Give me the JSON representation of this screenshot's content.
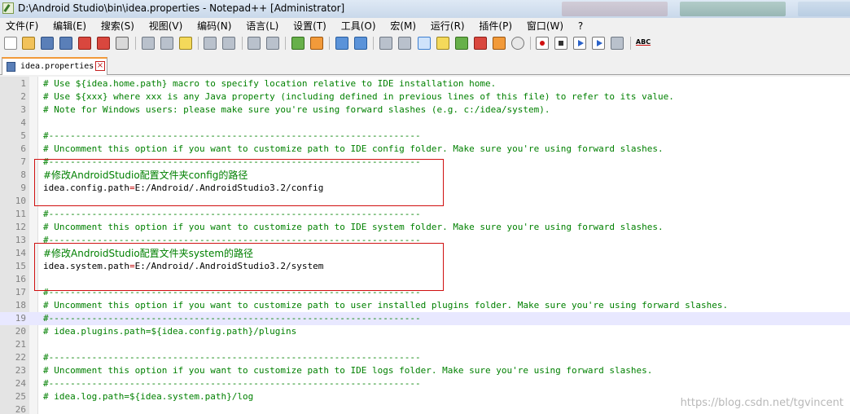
{
  "window": {
    "title": "D:\\Android Studio\\bin\\idea.properties - Notepad++ [Administrator]"
  },
  "menu": [
    "文件(F)",
    "编辑(E)",
    "搜索(S)",
    "视图(V)",
    "编码(N)",
    "语言(L)",
    "设置(T)",
    "工具(O)",
    "宏(M)",
    "运行(R)",
    "插件(P)",
    "窗口(W)",
    "?"
  ],
  "toolbar": {
    "spellcheck_label": "ABC"
  },
  "tab": {
    "label": "idea.properties",
    "close_glyph": "×"
  },
  "editor": {
    "lines": [
      {
        "n": "1",
        "text": "# Use ${idea.home.path} macro to specify location relative to IDE installation home."
      },
      {
        "n": "2",
        "text": "# Use ${xxx} where xxx is any Java property (including defined in previous lines of this file) to refer to its value."
      },
      {
        "n": "3",
        "text": "# Note for Windows users: please make sure you're using forward slashes (e.g. c:/idea/system)."
      },
      {
        "n": "4",
        "text": ""
      },
      {
        "n": "5",
        "text": "#---------------------------------------------------------------------"
      },
      {
        "n": "6",
        "text": "# Uncomment this option if you want to customize path to IDE config folder. Make sure you're using forward slashes."
      },
      {
        "n": "7",
        "text": "#---------------------------------------------------------------------"
      },
      {
        "n": "8",
        "text": "#修改AndroidStudio配置文件夹config的路径"
      },
      {
        "n": "9",
        "key": "idea.config.path",
        "value": "E:/Android/.AndroidStudio3.2/config"
      },
      {
        "n": "10",
        "text": ""
      },
      {
        "n": "11",
        "text": "#---------------------------------------------------------------------"
      },
      {
        "n": "12",
        "text": "# Uncomment this option if you want to customize path to IDE system folder. Make sure you're using forward slashes."
      },
      {
        "n": "13",
        "text": "#---------------------------------------------------------------------"
      },
      {
        "n": "14",
        "text": "#修改AndroidStudio配置文件夹system的路径"
      },
      {
        "n": "15",
        "key": "idea.system.path",
        "value": "E:/Android/.AndroidStudio3.2/system"
      },
      {
        "n": "16",
        "text": ""
      },
      {
        "n": "17",
        "text": "#---------------------------------------------------------------------"
      },
      {
        "n": "18",
        "text": "# Uncomment this option if you want to customize path to user installed plugins folder. Make sure you're using forward slashes."
      },
      {
        "n": "19",
        "text": "#---------------------------------------------------------------------"
      },
      {
        "n": "20",
        "text": "# idea.plugins.path=${idea.config.path}/plugins"
      },
      {
        "n": "21",
        "text": ""
      },
      {
        "n": "22",
        "text": "#---------------------------------------------------------------------"
      },
      {
        "n": "23",
        "text": "# Uncomment this option if you want to customize path to IDE logs folder. Make sure you're using forward slashes."
      },
      {
        "n": "24",
        "text": "#---------------------------------------------------------------------"
      },
      {
        "n": "25",
        "text": "# idea.log.path=${idea.system.path}/log"
      },
      {
        "n": "26",
        "text": ""
      }
    ],
    "current_line": "19"
  },
  "watermark": "https://blog.csdn.net/tgvincent",
  "colors": {
    "comment": "#008000",
    "operator": "#c00000",
    "annotation_box": "#d01010",
    "current_line_bg": "#e8e8ff"
  }
}
